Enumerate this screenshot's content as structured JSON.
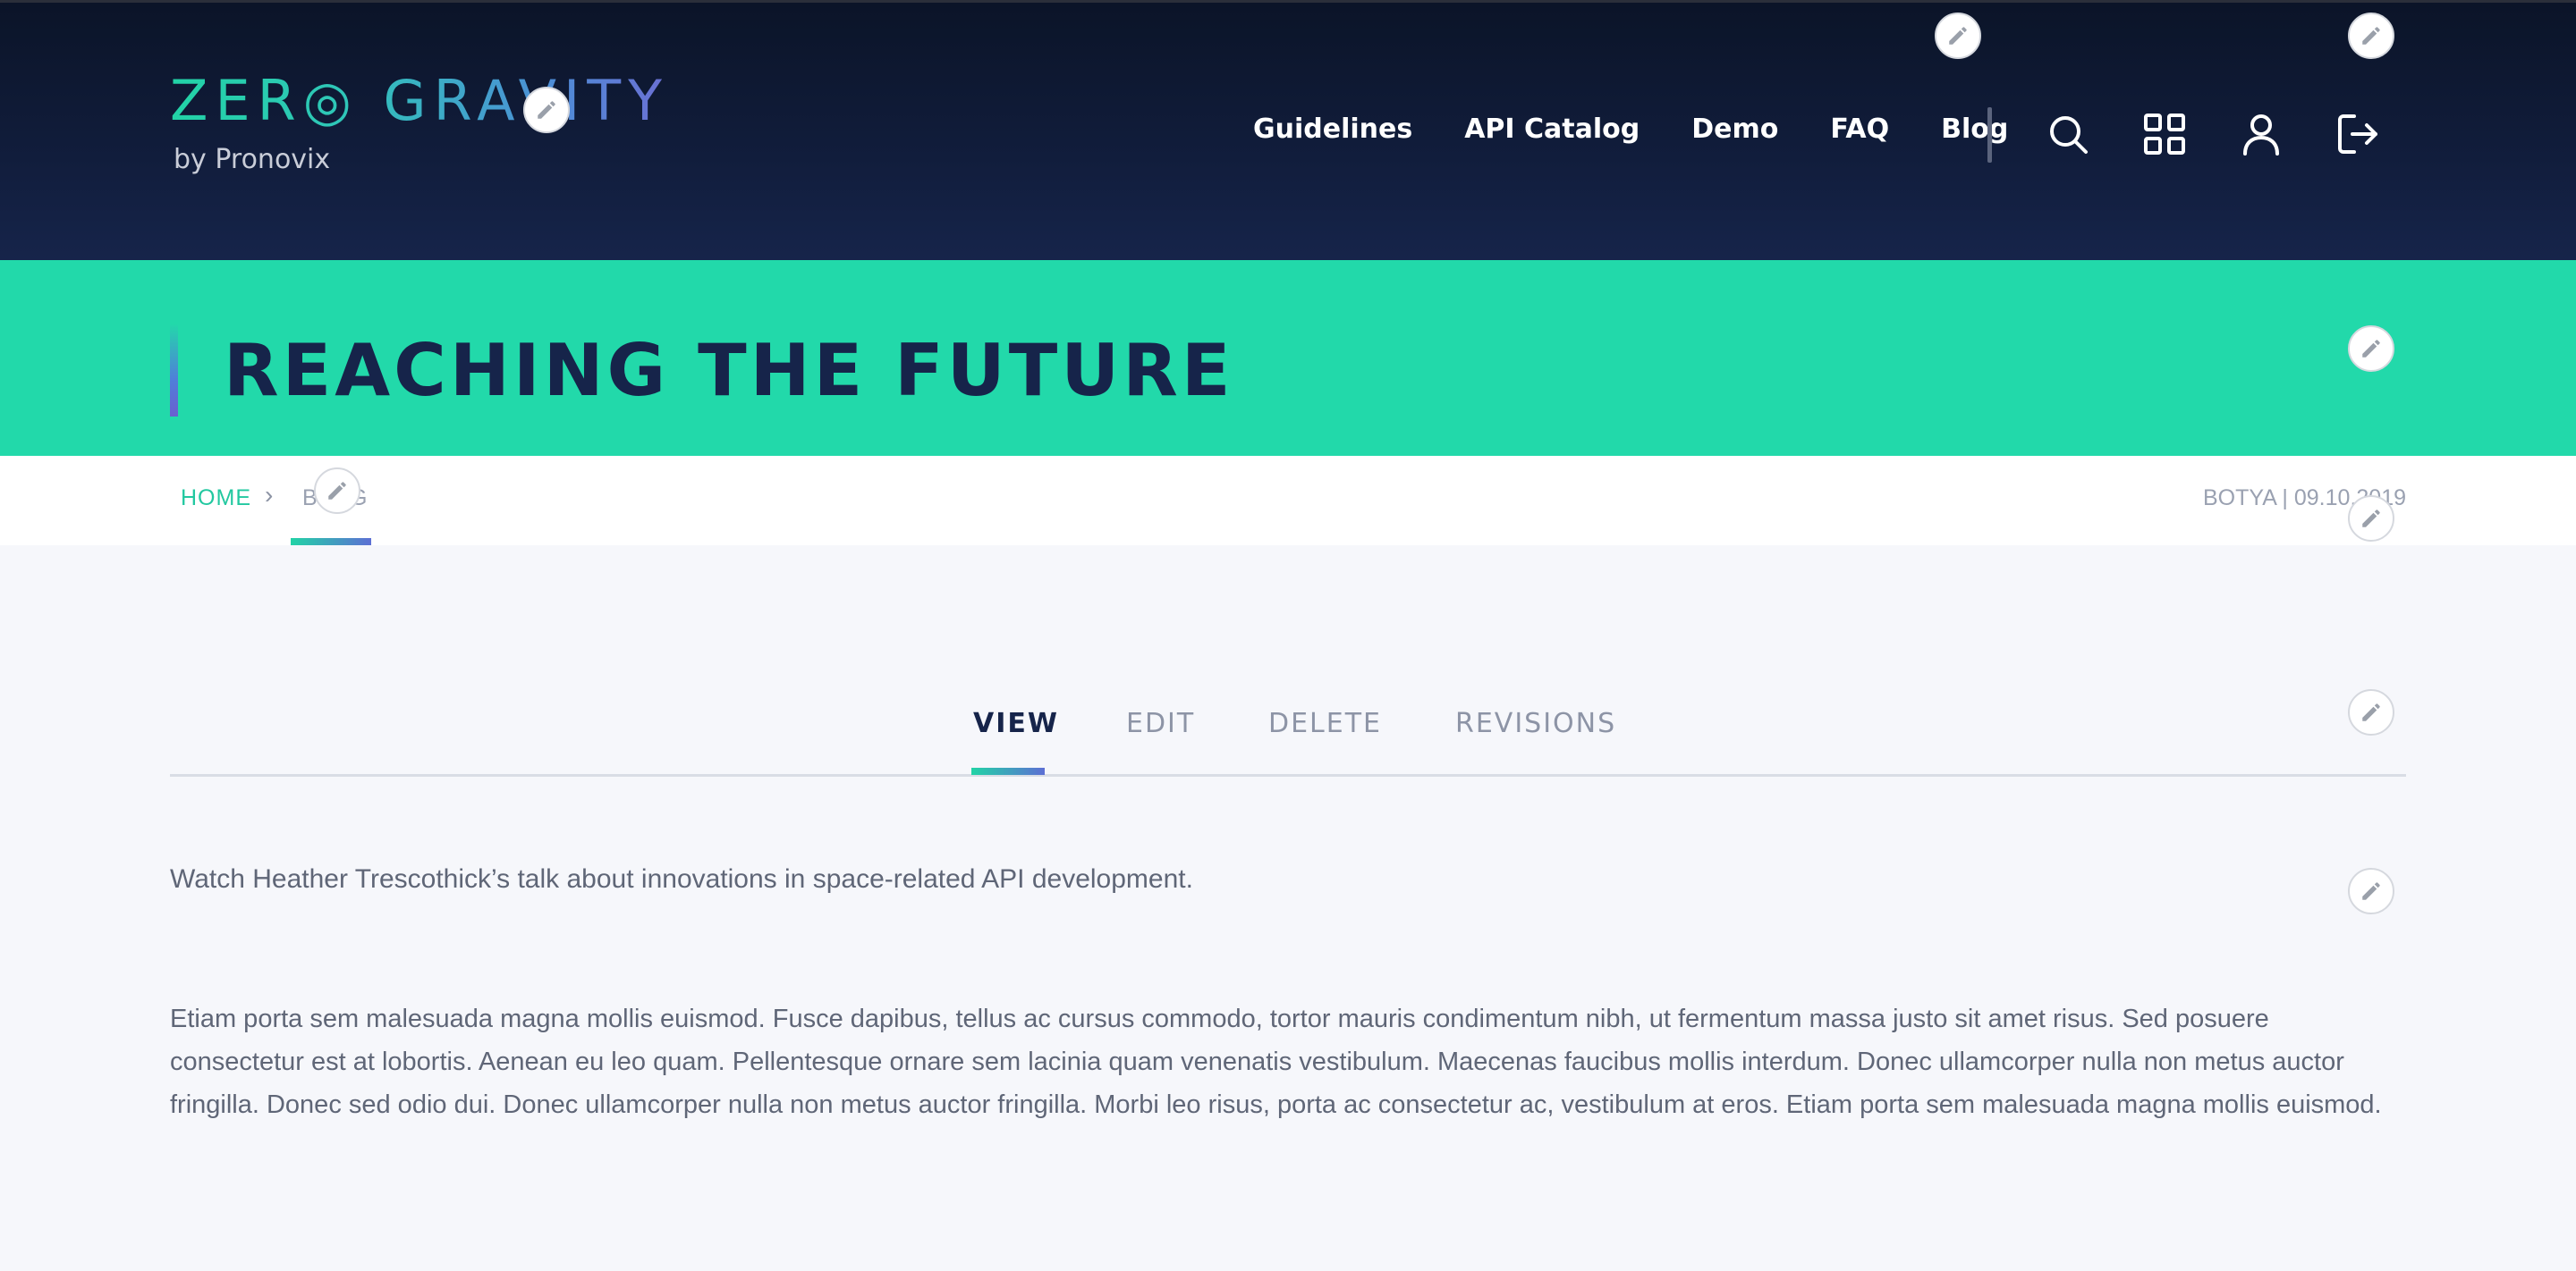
{
  "header": {
    "logo_main": "ZER◎ GRAVITY",
    "logo_sub": "by Pronovix",
    "nav": [
      "Guidelines",
      "API Catalog",
      "Demo",
      "FAQ",
      "Blog"
    ],
    "icons": [
      "search-icon",
      "grid-icon",
      "user-icon",
      "logout-icon"
    ]
  },
  "hero": {
    "title": "REACHING THE FUTURE"
  },
  "breadcrumb": {
    "home": "HOME",
    "separator": "›",
    "current": "BLOG"
  },
  "meta": "BOTYA | 09.10.2019",
  "tabs": [
    "VIEW",
    "EDIT",
    "DELETE",
    "REVISIONS"
  ],
  "content": {
    "lead": "Watch Heather Trescothick’s talk about innovations in space-related API development.",
    "body": "Etiam porta sem malesuada magna mollis euismod. Fusce dapibus, tellus ac cursus commodo, tortor mauris condimentum nibh, ut fermentum massa justo sit amet risus. Sed posuere consectetur est at lobortis. Aenean eu leo quam. Pellentesque ornare sem lacinia quam venenatis vestibulum. Maecenas faucibus mollis interdum. Donec ullamcorper nulla non metus auctor fringilla. Donec sed odio dui. Donec ullamcorper nulla non metus auctor fringilla. Morbi leo risus, porta ac consectetur ac, vestibulum at eros. Etiam porta sem malesuada magna mollis euismod."
  },
  "colors": {
    "header_bg": "#0f1a36",
    "hero_bg": "#22d9aa",
    "accent": "#22c8a0",
    "title": "#16244a",
    "body_text": "#5f6677"
  }
}
